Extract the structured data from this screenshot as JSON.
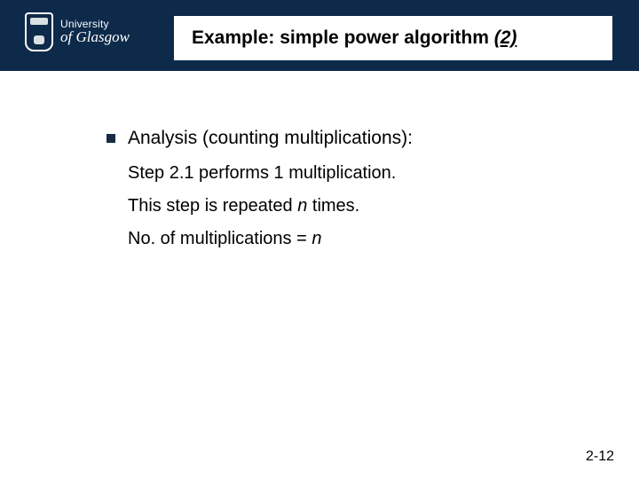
{
  "logo": {
    "line1": "University",
    "line2_pre": "of ",
    "line2_main": "Glasgow"
  },
  "title": {
    "main": "Example: simple power algorithm ",
    "suffix": "(2)"
  },
  "content": {
    "bullet1": "Analysis (counting multiplications):",
    "line1": "Step 2.1 performs 1 multiplication.",
    "line2_a": "This step is repeated ",
    "line2_n": "n",
    "line2_b": " times.",
    "line3_a": "No. of multiplications  =  ",
    "line3_n": "n"
  },
  "page_number": "2-12"
}
